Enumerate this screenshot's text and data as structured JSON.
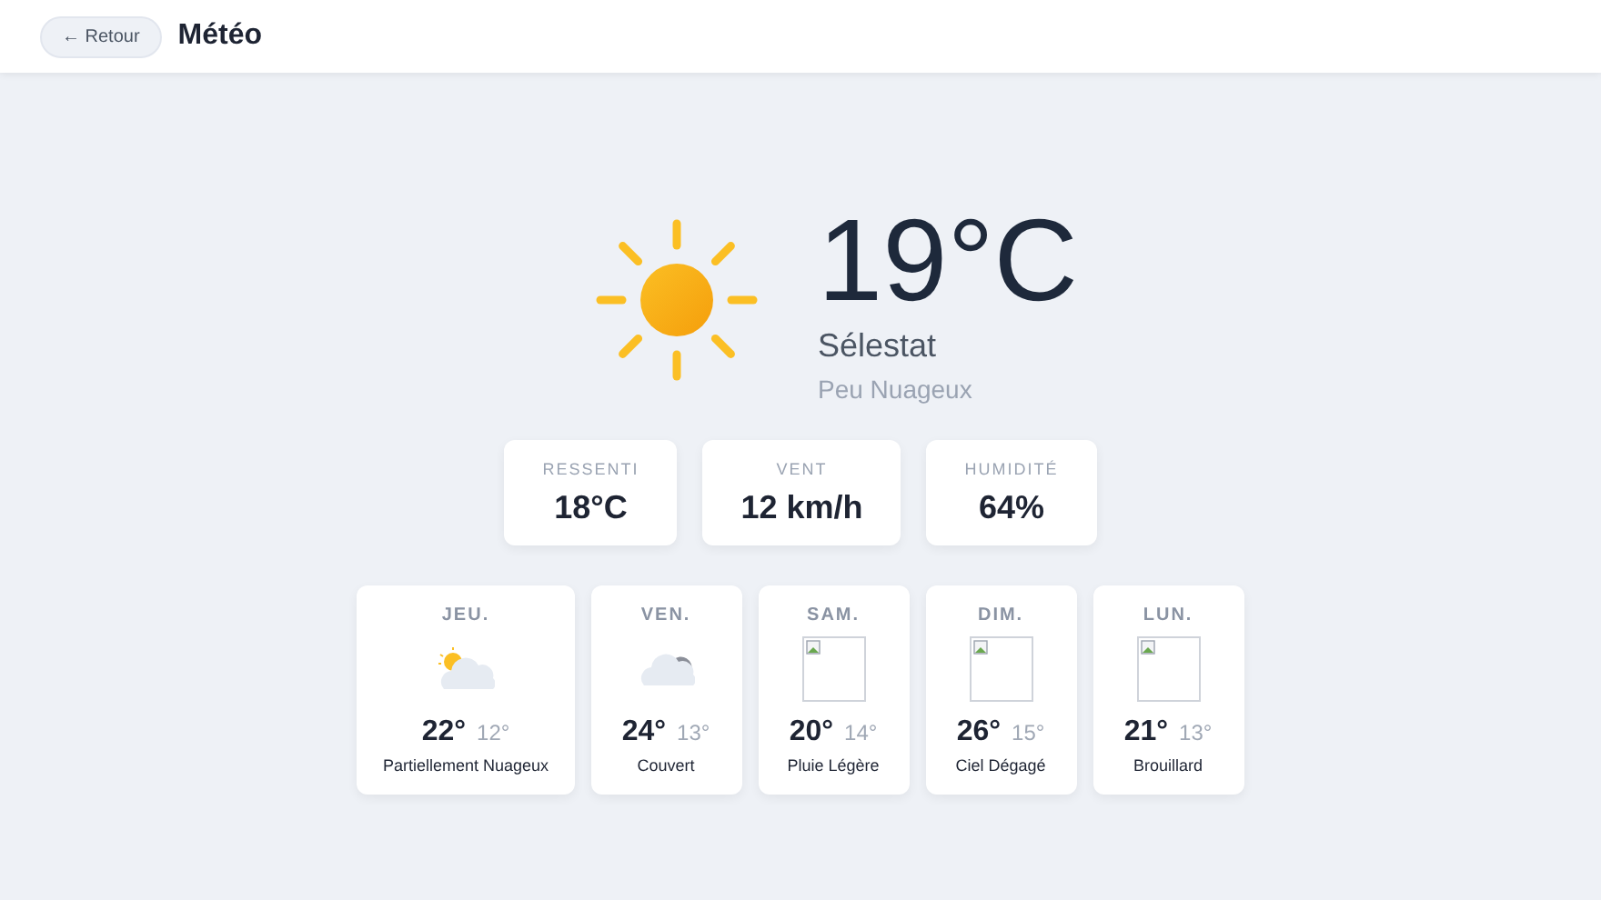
{
  "header": {
    "back_button": "← Retour",
    "title": "Météo"
  },
  "current": {
    "temperature": "19°C",
    "city": "Sélestat",
    "condition": "Peu Nuageux"
  },
  "stats": [
    {
      "label": "RESSENTI",
      "value": "18°C"
    },
    {
      "label": "VENT",
      "value": "12 km/h"
    },
    {
      "label": "HUMIDITÉ",
      "value": "64%"
    }
  ],
  "forecast": [
    {
      "kind": "partly",
      "day": "JEU.",
      "high": "22°",
      "low": "12°",
      "condition": "Partiellement Nuageux"
    },
    {
      "kind": "overcast",
      "day": "VEN.",
      "high": "24°",
      "low": "13°",
      "condition": "Couvert"
    },
    {
      "kind": "missing",
      "day": "SAM.",
      "high": "20°",
      "low": "14°",
      "condition": "Pluie Légère"
    },
    {
      "kind": "missing",
      "day": "DIM.",
      "high": "26°",
      "low": "15°",
      "condition": "Ciel Dégagé"
    },
    {
      "kind": "missing",
      "day": "LUN.",
      "high": "21°",
      "low": "13°",
      "condition": "Brouillard"
    }
  ]
}
